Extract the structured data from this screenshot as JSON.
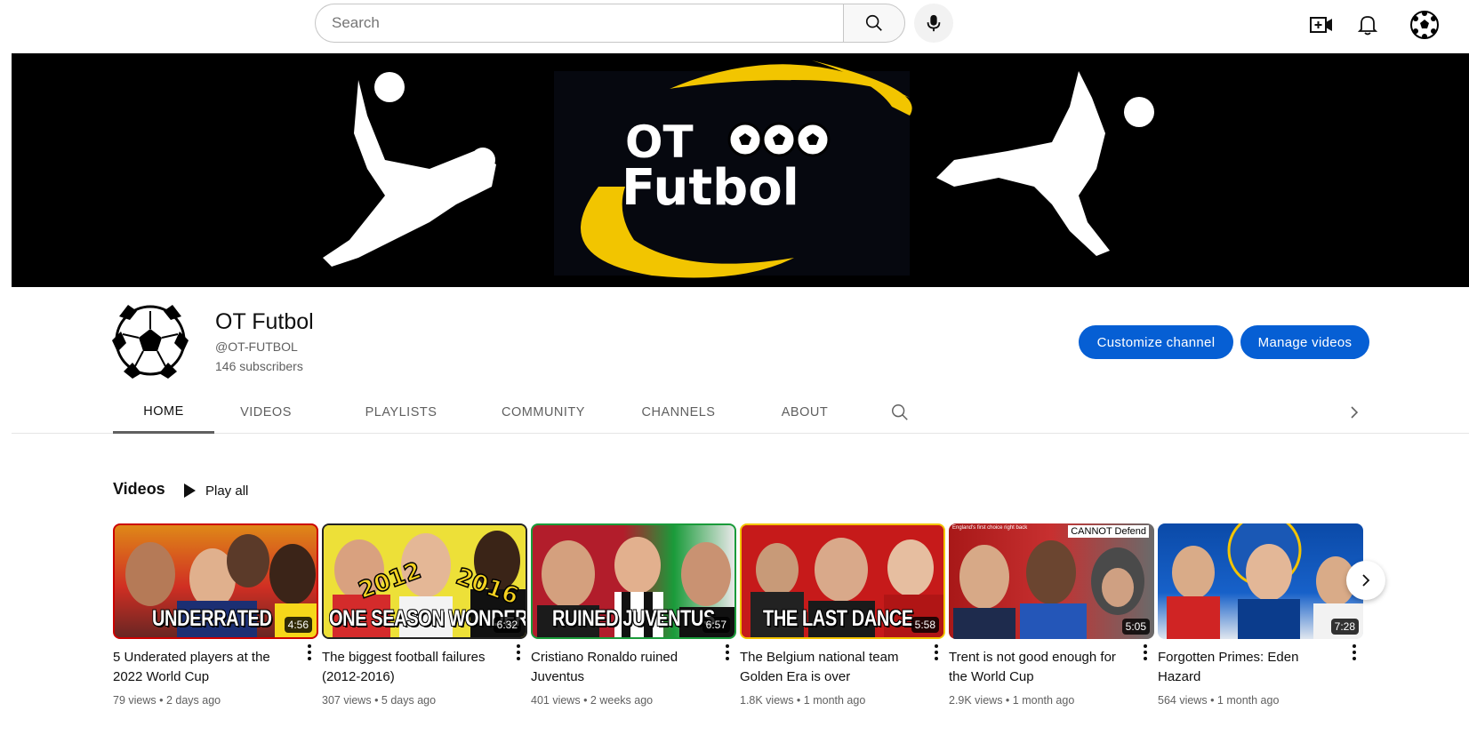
{
  "search": {
    "placeholder": "Search"
  },
  "banner": {
    "logo_line1": "OT",
    "logo_line2": "Futbol"
  },
  "channel": {
    "name": "OT Futbol",
    "handle": "@OT-FUTBOL",
    "subscribers": "146 subscribers",
    "customize_label": "Customize channel",
    "manage_label": "Manage videos"
  },
  "tabs": [
    "HOME",
    "VIDEOS",
    "PLAYLISTS",
    "COMMUNITY",
    "CHANNELS",
    "ABOUT"
  ],
  "section": {
    "title": "Videos",
    "play_all": "Play all"
  },
  "videos": [
    {
      "title": "5 Underated players at the 2022 World Cup",
      "views": "79 views",
      "age": "2 days ago",
      "duration": "4:56",
      "caption": "UNDERRATED"
    },
    {
      "title": "The biggest football failures (2012-2016)",
      "views": "307 views",
      "age": "5 days ago",
      "duration": "6:32",
      "caption": "ONE SEASON WONDERS"
    },
    {
      "title": "Cristiano Ronaldo ruined Juventus",
      "views": "401 views",
      "age": "2 weeks ago",
      "duration": "6:57",
      "caption": "RUINED JUVENTUS"
    },
    {
      "title": "The Belgium national team Golden Era is over",
      "views": "1.8K views",
      "age": "1 month ago",
      "duration": "5:58",
      "caption": "THE LAST DANCE"
    },
    {
      "title": "Trent is not good enough for the World Cup",
      "views": "2.9K views",
      "age": "1 month ago",
      "duration": "5:05",
      "caption": "",
      "tag": "CANNOT Defend",
      "tag_left": "England's first choice right back"
    },
    {
      "title": "Forgotten Primes: Eden Hazard",
      "views": "564 views",
      "age": "1 month ago",
      "duration": "7:28",
      "caption": ""
    }
  ],
  "colors": {
    "accent": "#065fd4",
    "logo_yellow": "#f2c500",
    "banner_bg": "#000000"
  }
}
